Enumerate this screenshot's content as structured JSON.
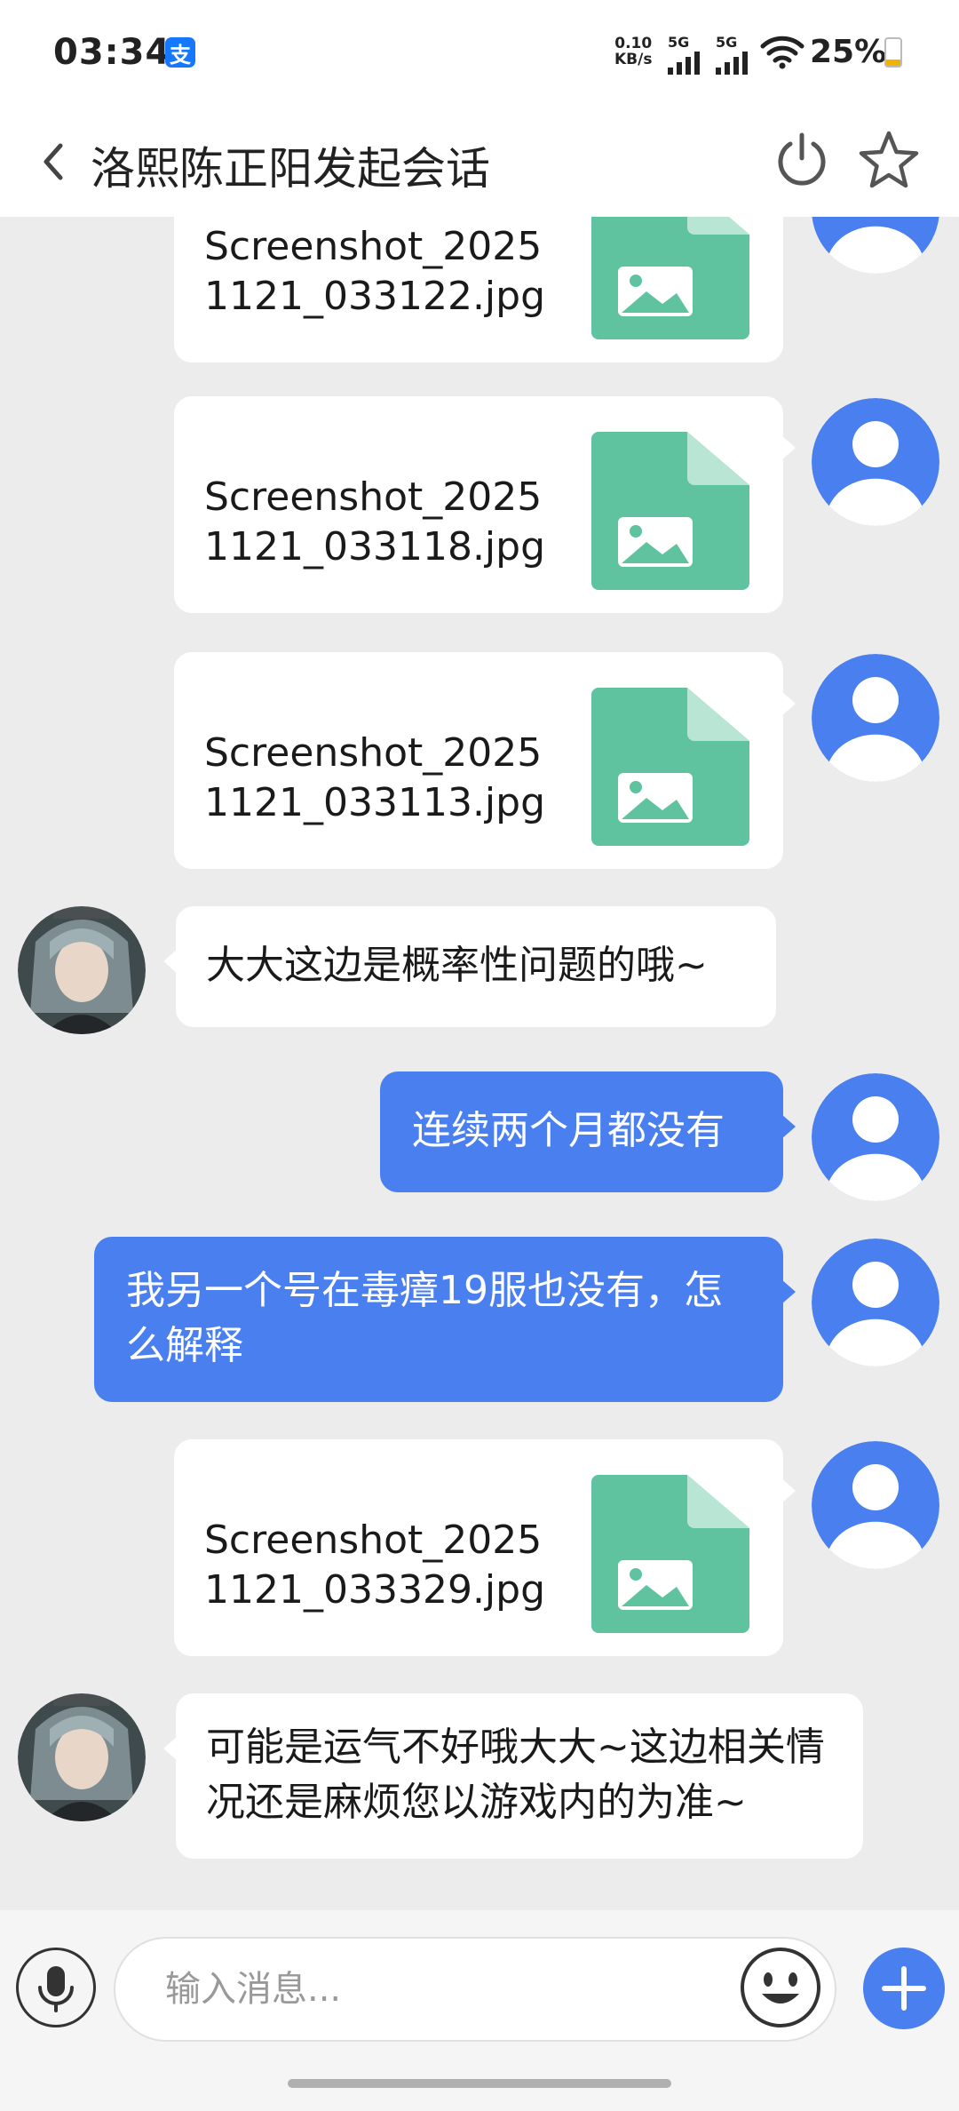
{
  "status_bar": {
    "time": "03:34",
    "alipay_glyph": "支",
    "net_speed_value": "0.10",
    "net_speed_unit": "KB/s",
    "signal_1_label": "5G",
    "signal_2_label": "5G",
    "battery_percent": "25%",
    "battery_level": 0.25,
    "battery_color": "#f0b400"
  },
  "header": {
    "back_icon": "chevron-left-icon",
    "title": "洛熙陈正阳发起会话",
    "power_icon": "power-icon",
    "star_icon": "star-outline-icon"
  },
  "theme": {
    "accent": "#4a7ff0",
    "file_icon": "#5fc39f",
    "chat_background": "#ececec"
  },
  "messages": [
    {
      "sender": "self",
      "type": "file",
      "file_name": "Screenshot_20251121_033122.jpg"
    },
    {
      "sender": "self",
      "type": "file",
      "file_name": "Screenshot_20251121_033118.jpg"
    },
    {
      "sender": "self",
      "type": "file",
      "file_name": "Screenshot_20251121_033113.jpg"
    },
    {
      "sender": "agent",
      "type": "text",
      "text": "大大这边是概率性问题的哦~"
    },
    {
      "sender": "self",
      "type": "text",
      "text": "连续两个月都没有"
    },
    {
      "sender": "self",
      "type": "text",
      "text": "我另一个号在毒瘴19服也没有，怎么解释"
    },
    {
      "sender": "self",
      "type": "file",
      "file_name": "Screenshot_20251121_033329.jpg"
    },
    {
      "sender": "agent",
      "type": "text",
      "text": "可能是运气不好哦大大~这边相关情况还是麻烦您以游戏内的为准~"
    }
  ],
  "input_bar": {
    "placeholder": "输入消息...",
    "mic_icon": "microphone-icon",
    "emoji_icon": "smiley-icon",
    "plus_icon": "plus-icon"
  }
}
